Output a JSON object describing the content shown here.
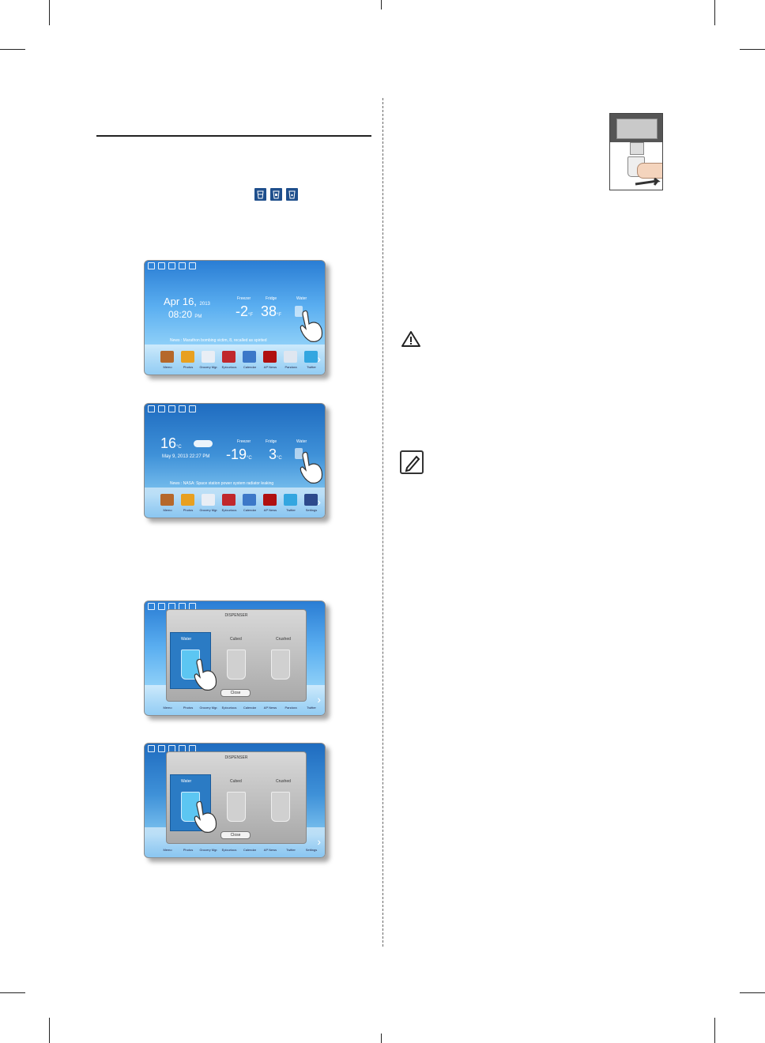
{
  "screens": [
    {
      "date": "Apr 16,",
      "year": "2013",
      "time": "08:20",
      "ampm": "PM",
      "labels": [
        "Freezer",
        "Fridge",
        "Water"
      ],
      "freezer_value": "-2",
      "fridge_value": "38",
      "unit": "°F",
      "news": "News : Marathon bombing victim, 8, recalled as spirited",
      "apps": [
        "Memo",
        "Photos",
        "Grocery Mgr.",
        "Epicurious",
        "Calendar",
        "AP News",
        "Pandora",
        "Twitter"
      ]
    },
    {
      "temp": "16",
      "temp_unit": "°C",
      "date_line": "May 9, 2013  22:27",
      "ampm": "PM",
      "labels": [
        "Freezer",
        "Fridge",
        "Water"
      ],
      "freezer_value": "-19",
      "fridge_value": "3",
      "unit": "°C",
      "news": "News : NASA: Space station power system radiator leaking",
      "apps": [
        "Memo",
        "Photos",
        "Grocery Mgr.",
        "Epicurious",
        "Calendar",
        "AP News",
        "Twitter",
        "Settings"
      ]
    }
  ],
  "dispenser": {
    "title": "DISPENSER",
    "options": [
      "Water",
      "Cubed",
      "Crushed"
    ],
    "close_label": "Close",
    "apps_a": [
      "Memo",
      "Photos",
      "Grocery Mgr.",
      "Epicurious",
      "Calendar",
      "AP News",
      "Pandora",
      "Twitter"
    ],
    "apps_b": [
      "Memo",
      "Photos",
      "Grocery Mgr.",
      "Epicurious",
      "Calendar",
      "AP News",
      "Twitter",
      "Settings"
    ]
  },
  "icons": [
    "water-mode-icon",
    "cubed-ice-icon",
    "crushed-ice-icon",
    "warning-icon",
    "note-icon"
  ],
  "colors": {
    "screen_blue": "#2a7dd4",
    "icon_blue": "#1f4f8c"
  }
}
